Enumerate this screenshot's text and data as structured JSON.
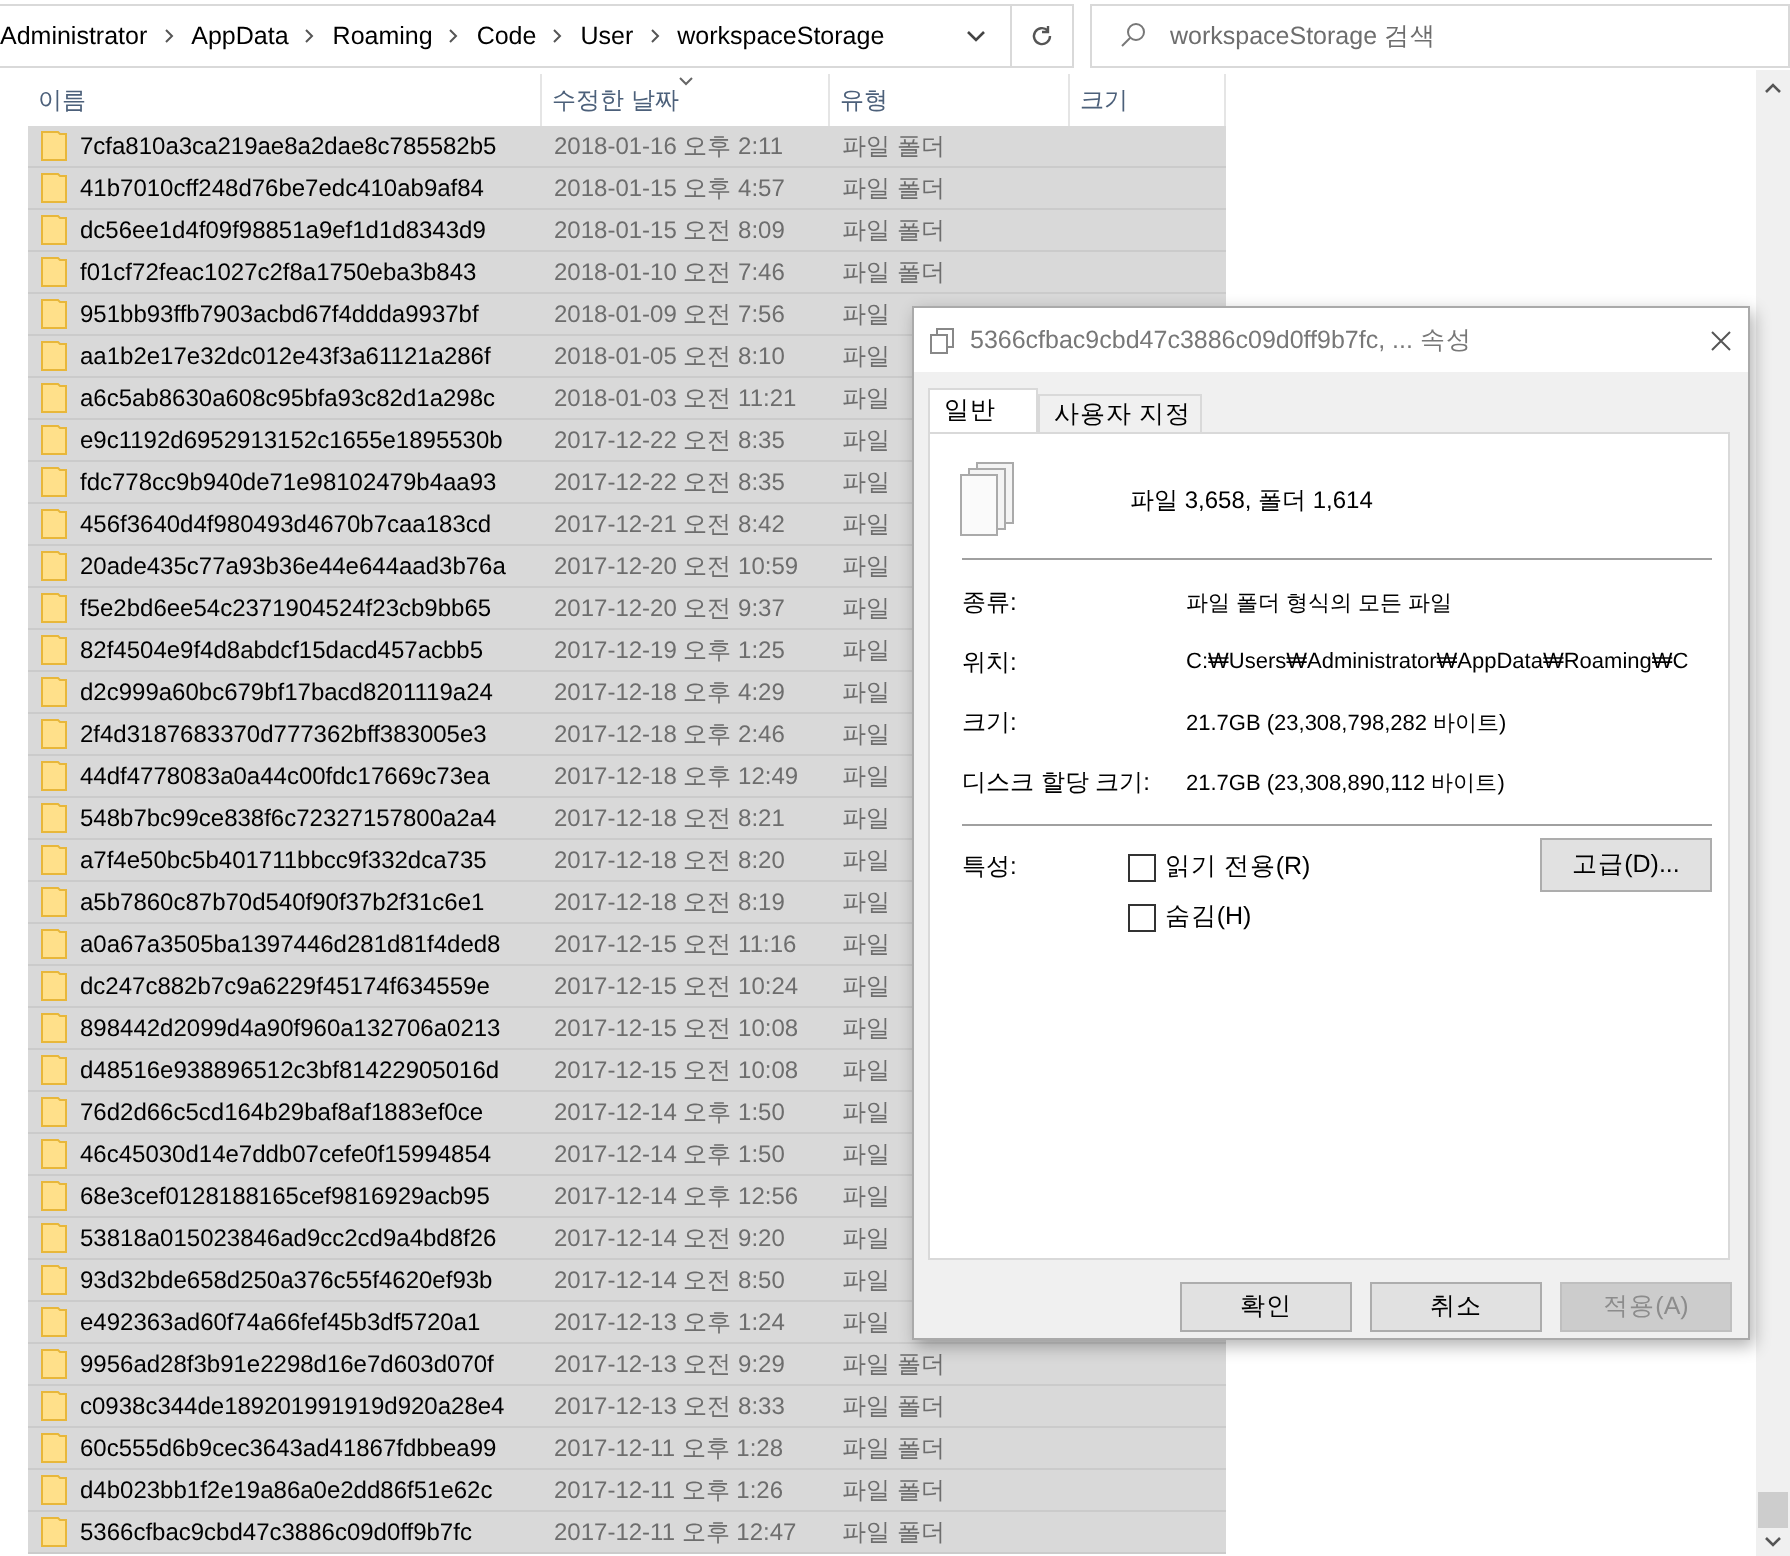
{
  "address_bar": {
    "path": [
      "Administrator",
      "AppData",
      "Roaming",
      "Code",
      "User",
      "workspaceStorage"
    ]
  },
  "search": {
    "placeholder": "workspaceStorage 검색"
  },
  "columns": [
    {
      "label": "이름",
      "sorted": false
    },
    {
      "label": "수정한 날짜",
      "sorted": true
    },
    {
      "label": "유형",
      "sorted": false
    },
    {
      "label": "크기",
      "sorted": false
    }
  ],
  "rows": [
    {
      "name": "7cfa810a3ca219ae8a2dae8c785582b5",
      "modified": "2018-01-16 오후 2:11",
      "type": "파일 폴더",
      "selected": true
    },
    {
      "name": "41b7010cff248d76be7edc410ab9af84",
      "modified": "2018-01-15 오후 4:57",
      "type": "파일 폴더",
      "selected": true
    },
    {
      "name": "dc56ee1d4f09f98851a9ef1d1d8343d9",
      "modified": "2018-01-15 오전 8:09",
      "type": "파일 폴더",
      "selected": true
    },
    {
      "name": "f01cf72feac1027c2f8a1750eba3b843",
      "modified": "2018-01-10 오전 7:46",
      "type": "파일 폴더",
      "selected": true
    },
    {
      "name": "951bb93ffb7903acbd67f4ddda9937bf",
      "modified": "2018-01-09 오전 7:56",
      "type": "파일",
      "selected": true
    },
    {
      "name": "aa1b2e17e32dc012e43f3a61121a286f",
      "modified": "2018-01-05 오전 8:10",
      "type": "파일",
      "selected": true
    },
    {
      "name": "a6c5ab8630a608c95bfa93c82d1a298c",
      "modified": "2018-01-03 오전 11:21",
      "type": "파일",
      "selected": true
    },
    {
      "name": "e9c1192d6952913152c1655e1895530b",
      "modified": "2017-12-22 오전 8:35",
      "type": "파일",
      "selected": true
    },
    {
      "name": "fdc778cc9b940de71e98102479b4aa93",
      "modified": "2017-12-22 오전 8:35",
      "type": "파일",
      "selected": true
    },
    {
      "name": "456f3640d4f980493d4670b7caa183cd",
      "modified": "2017-12-21 오전 8:42",
      "type": "파일",
      "selected": true
    },
    {
      "name": "20ade435c77a93b36e44e644aad3b76a",
      "modified": "2017-12-20 오전 10:59",
      "type": "파일",
      "selected": true
    },
    {
      "name": "f5e2bd6ee54c2371904524f23cb9bb65",
      "modified": "2017-12-20 오전 9:37",
      "type": "파일",
      "selected": true
    },
    {
      "name": "82f4504e9f4d8abdcf15dacd457acbb5",
      "modified": "2017-12-19 오후 1:25",
      "type": "파일",
      "selected": true
    },
    {
      "name": "d2c999a60bc679bf17bacd8201119a24",
      "modified": "2017-12-18 오후 4:29",
      "type": "파일",
      "selected": true
    },
    {
      "name": "2f4d3187683370d777362bff383005e3",
      "modified": "2017-12-18 오후 2:46",
      "type": "파일",
      "selected": true
    },
    {
      "name": "44df4778083a0a44c00fdc17669c73ea",
      "modified": "2017-12-18 오후 12:49",
      "type": "파일",
      "selected": true
    },
    {
      "name": "548b7bc99ce838f6c72327157800a2a4",
      "modified": "2017-12-18 오전 8:21",
      "type": "파일",
      "selected": true
    },
    {
      "name": "a7f4e50bc5b401711bbcc9f332dca735",
      "modified": "2017-12-18 오전 8:20",
      "type": "파일",
      "selected": true
    },
    {
      "name": "a5b7860c87b70d540f90f37b2f31c6e1",
      "modified": "2017-12-18 오전 8:19",
      "type": "파일",
      "selected": true
    },
    {
      "name": "a0a67a3505ba1397446d281d81f4ded8",
      "modified": "2017-12-15 오전 11:16",
      "type": "파일",
      "selected": true
    },
    {
      "name": "dc247c882b7c9a6229f45174f634559e",
      "modified": "2017-12-15 오전 10:24",
      "type": "파일",
      "selected": true
    },
    {
      "name": "898442d2099d4a90f960a132706a0213",
      "modified": "2017-12-15 오전 10:08",
      "type": "파일",
      "selected": true
    },
    {
      "name": "d48516e938896512c3bf81422905016d",
      "modified": "2017-12-15 오전 10:08",
      "type": "파일",
      "selected": true
    },
    {
      "name": "76d2d66c5cd164b29baf8af1883ef0ce",
      "modified": "2017-12-14 오후 1:50",
      "type": "파일",
      "selected": true
    },
    {
      "name": "46c45030d14e7ddb07cefe0f15994854",
      "modified": "2017-12-14 오후 1:50",
      "type": "파일",
      "selected": true
    },
    {
      "name": "68e3cef0128188165cef9816929acb95",
      "modified": "2017-12-14 오후 12:56",
      "type": "파일",
      "selected": true
    },
    {
      "name": "53818a015023846ad9cc2cd9a4bd8f26",
      "modified": "2017-12-14 오전 9:20",
      "type": "파일",
      "selected": true
    },
    {
      "name": "93d32bde658d250a376c55f4620ef93b",
      "modified": "2017-12-14 오전 8:50",
      "type": "파일",
      "selected": true
    },
    {
      "name": "e492363ad60f74a66fef45b3df5720a1",
      "modified": "2017-12-13 오후 1:24",
      "type": "파일",
      "selected": true
    },
    {
      "name": "9956ad28f3b91e2298d16e7d603d070f",
      "modified": "2017-12-13 오전 9:29",
      "type": "파일 폴더",
      "selected": true
    },
    {
      "name": "c0938c344de189201991919d920a28e4",
      "modified": "2017-12-13 오전 8:33",
      "type": "파일 폴더",
      "selected": true
    },
    {
      "name": "60c555d6b9cec3643ad41867fdbbea99",
      "modified": "2017-12-11 오후 1:28",
      "type": "파일 폴더",
      "selected": true
    },
    {
      "name": "d4b023bb1f2e19a86a0e2dd86f51e62c",
      "modified": "2017-12-11 오후 1:26",
      "type": "파일 폴더",
      "selected": true
    },
    {
      "name": "5366cfbac9cbd47c3886c09d0ff9b7fc",
      "modified": "2017-12-11 오후 12:47",
      "type": "파일 폴더",
      "selected": true
    }
  ],
  "dialog": {
    "title": "5366cfbac9cbd47c3886c09d0ff9b7fc, ... 속성",
    "tabs": [
      {
        "label": "일반",
        "selected": true
      },
      {
        "label": "사용자 지정",
        "selected": false
      }
    ],
    "summary": "파일 3,658, 폴더 1,614",
    "properties": [
      {
        "label": "종류:",
        "value": "파일 폴더 형식의 모든 파일"
      },
      {
        "label": "위치:",
        "value": "C:₩Users₩Administrator₩AppData₩Roaming₩C"
      },
      {
        "label": "크기:",
        "value": "21.7GB (23,308,798,282 바이트)"
      },
      {
        "label": "디스크 할당 크기:",
        "value": "21.7GB (23,308,890,112 바이트)"
      }
    ],
    "attributes_label": "특성:",
    "checkboxes": [
      {
        "label": "읽기 전용(R)",
        "checked": false
      },
      {
        "label": "숨김(H)",
        "checked": false
      }
    ],
    "advanced_button": "고급(D)...",
    "buttons": [
      {
        "label": "확인",
        "disabled": false
      },
      {
        "label": "취소",
        "disabled": false
      },
      {
        "label": "적용(A)",
        "disabled": true
      }
    ]
  }
}
